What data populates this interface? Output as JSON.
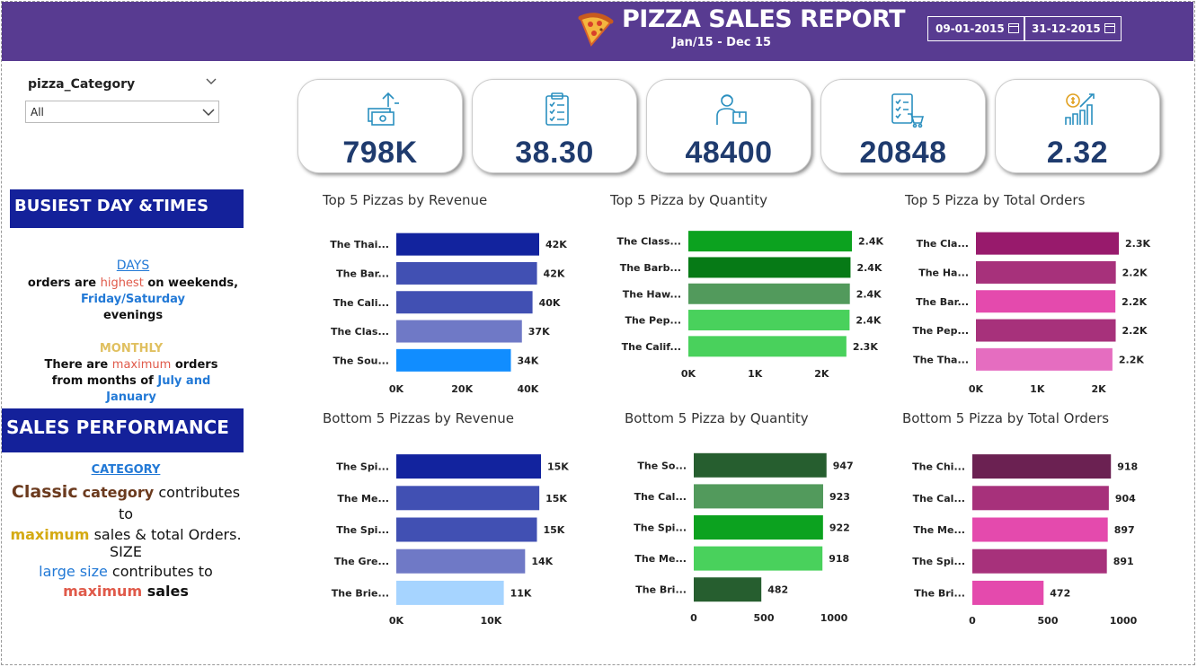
{
  "header": {
    "title": "PIZZA SALES REPORT",
    "subtitle": "Jan/15 - Dec 15",
    "start_date": "09-01-2015",
    "end_date": "31-12-2015",
    "bg_color": "#583b91"
  },
  "slicer": {
    "title": "pizza_Category",
    "value": "All"
  },
  "busiest": {
    "banner": "BUSIEST DAY &TIMES",
    "days_label": "DAYS",
    "days_line1_a": "orders are",
    "days_line1_b": "highest",
    "days_line1_c": "on  weekends,",
    "days_line2": "Friday/Saturday",
    "days_line3": "evenings",
    "monthly_label": "MONTHLY",
    "monthly_line1_a": "There are",
    "monthly_line1_b": "maximum",
    "monthly_line1_c": "orders",
    "monthly_line2_a": "from months of",
    "monthly_line2_b": "July and",
    "monthly_line3": "January"
  },
  "performance": {
    "banner": "SALES  PERFORMANCE",
    "category_label": "CATEGORY",
    "cat_line1_a": "Classic",
    "cat_line1_b": "category",
    "cat_line1_c": "contributes to",
    "cat_line2_a": "maximum",
    "cat_line2_b": "sales & total Orders.",
    "size_label": "SIZE",
    "size_line1_a": "large size",
    "size_line1_b": "contributes to",
    "size_line2_a": "maximum",
    "size_line2_b": "sales"
  },
  "kpis": [
    {
      "value": "798K",
      "icon": "money-transfer-icon"
    },
    {
      "value": "38.30",
      "icon": "clipboard-checklist-icon"
    },
    {
      "value": "48400",
      "icon": "delivery-person-icon"
    },
    {
      "value": "20848",
      "icon": "order-cart-checklist-icon"
    },
    {
      "value": "2.32",
      "icon": "growth-chart-icon"
    }
  ],
  "chart_data": [
    {
      "id": "top-revenue",
      "type": "bar",
      "orientation": "horizontal",
      "title": "Top 5 Pizzas by Revenue",
      "categories": [
        "The Thai...",
        "The Bar...",
        "The Cali...",
        "The Clas...",
        "The Sou..."
      ],
      "values": [
        43434,
        42768,
        41410,
        38180,
        34831
      ],
      "value_labels": [
        "42K",
        "42K",
        "40K",
        "37K",
        "34K"
      ],
      "colors": [
        "#12239e",
        "#4150b3",
        "#4150b3",
        "#6f79c6",
        "#118dff"
      ],
      "xticks": [
        0,
        20000,
        40000
      ],
      "xtick_labels": [
        "0K",
        "20K",
        "40K"
      ],
      "xlim": [
        0,
        43434
      ]
    },
    {
      "id": "top-quantity",
      "type": "bar",
      "orientation": "horizontal",
      "title": "Top 5 Pizza by Quantity",
      "categories": [
        "The Class...",
        "The Barb...",
        "The Haw...",
        "The Pep...",
        "The Calif..."
      ],
      "values": [
        2453,
        2432,
        2422,
        2418,
        2370
      ],
      "value_labels": [
        "2.4K",
        "2.4K",
        "2.4K",
        "2.4K",
        "2.3K"
      ],
      "colors": [
        "#0ca21f",
        "#067a16",
        "#529a5c",
        "#49d15c",
        "#49d15c"
      ],
      "xticks": [
        0,
        1000,
        2000
      ],
      "xtick_labels": [
        "0K",
        "1K",
        "2K"
      ],
      "xlim": [
        0,
        2453
      ]
    },
    {
      "id": "top-orders",
      "type": "bar",
      "orientation": "horizontal",
      "title": "Top 5 Pizza by Total Orders",
      "categories": [
        "The Cla...",
        "The Ha...",
        "The Bar...",
        "The Pep...",
        "The Tha..."
      ],
      "values": [
        2329,
        2280,
        2273,
        2278,
        2225
      ],
      "value_labels": [
        "2.3K",
        "2.2K",
        "2.2K",
        "2.2K",
        "2.2K"
      ],
      "colors": [
        "#981a6c",
        "#a7317b",
        "#e44aad",
        "#a7317b",
        "#e56dc0"
      ],
      "xticks": [
        0,
        1000,
        2000
      ],
      "xtick_labels": [
        "0K",
        "1K",
        "2K"
      ],
      "xlim": [
        0,
        2329
      ]
    },
    {
      "id": "bottom-revenue",
      "type": "bar",
      "orientation": "horizontal",
      "title": "Bottom 5 Pizzas by Revenue",
      "categories": [
        "The Spi...",
        "The Me...",
        "The Spi...",
        "The Gre...",
        "The Brie..."
      ],
      "values": [
        15277,
        15100,
        14850,
        13600,
        11350
      ],
      "value_labels": [
        "15K",
        "15K",
        "15K",
        "14K",
        "11K"
      ],
      "colors": [
        "#12239e",
        "#4150b3",
        "#4150b3",
        "#6f79c6",
        "#a6d4ff"
      ],
      "xticks": [
        0,
        10000
      ],
      "xtick_labels": [
        "0K",
        "10K"
      ],
      "xlim": [
        0,
        15277
      ]
    },
    {
      "id": "bottom-quantity",
      "type": "bar",
      "orientation": "horizontal",
      "title": "Bottom 5 Pizza by Quantity",
      "categories": [
        "The So...",
        "The Cal...",
        "The Spi...",
        "The Me...",
        "The Bri..."
      ],
      "values": [
        947,
        923,
        922,
        918,
        482
      ],
      "value_labels": [
        "947",
        "923",
        "922",
        "918",
        "482"
      ],
      "colors": [
        "#265e2f",
        "#529a5c",
        "#0ca21f",
        "#49d15c",
        "#265e2f"
      ],
      "xticks": [
        0,
        500,
        1000
      ],
      "xtick_labels": [
        "0",
        "500",
        "1000"
      ],
      "xlim": [
        0,
        1000
      ]
    },
    {
      "id": "bottom-orders",
      "type": "bar",
      "orientation": "horizontal",
      "title": "Bottom 5 Pizza by Total Orders",
      "categories": [
        "The Chi...",
        "The Cal...",
        "The Me...",
        "The Spi...",
        "The Bri..."
      ],
      "values": [
        918,
        904,
        897,
        891,
        472
      ],
      "value_labels": [
        "918",
        "904",
        "897",
        "891",
        "472"
      ],
      "colors": [
        "#6b2152",
        "#a7317b",
        "#e44aad",
        "#a7317b",
        "#e44aad"
      ],
      "xticks": [
        0,
        500,
        1000
      ],
      "xtick_labels": [
        "0",
        "500",
        "1000"
      ],
      "xlim": [
        0,
        1000
      ]
    }
  ]
}
